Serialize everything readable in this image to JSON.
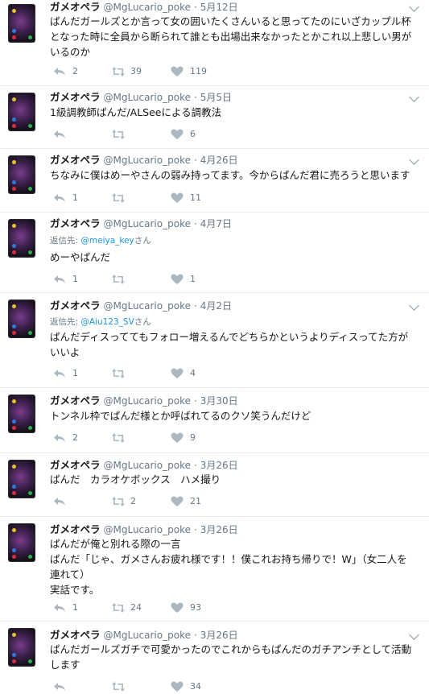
{
  "account": {
    "name": "ガメオペラ",
    "handle": "@MgLucario_poke",
    "sep": "·"
  },
  "tweets": [
    {
      "date": "5月12日",
      "reply_label": "",
      "reply_mention": "",
      "reply_suffix": "",
      "lines": [
        "ぱんだガールズとか言って女の囲いたくさんいると思ってたのにいざカップル杯",
        "となった時に全員から断られて誰とも出場出来なかったとかこれ以上悲しい男が",
        "いるのか"
      ],
      "replies": "2",
      "retweets": "39",
      "likes": "119"
    },
    {
      "date": "5月5日",
      "reply_label": "",
      "reply_mention": "",
      "reply_suffix": "",
      "lines": [
        "1級調教師ぱんだ/ALSeeによる調教法"
      ],
      "replies": "",
      "retweets": "",
      "likes": "6"
    },
    {
      "date": "4月26日",
      "reply_label": "",
      "reply_mention": "",
      "reply_suffix": "",
      "lines": [
        "ちなみに僕はめーやさんの弱み持ってます。今からぱんだ君に売ろうと思います"
      ],
      "replies": "1",
      "retweets": "",
      "likes": "11"
    },
    {
      "date": "4月7日",
      "reply_label": "返信先: ",
      "reply_mention": "@meiya_key",
      "reply_suffix": "さん",
      "lines": [
        "めーやぱんだ"
      ],
      "replies": "1",
      "retweets": "",
      "likes": "1"
    },
    {
      "date": "4月2日",
      "reply_label": "返信先: ",
      "reply_mention": "@Aiu123_SV",
      "reply_suffix": "さん",
      "lines": [
        "ぱんだディスっててもフォロー増えるんでどちらかというよりディスってた方が",
        "いいよ"
      ],
      "replies": "1",
      "retweets": "",
      "likes": "4"
    },
    {
      "date": "3月30日",
      "reply_label": "",
      "reply_mention": "",
      "reply_suffix": "",
      "lines": [
        "トンネル枠でぱんだ様とか呼ばれてるのクソ笑うんだけど"
      ],
      "replies": "2",
      "retweets": "",
      "likes": "9"
    },
    {
      "date": "3月26日",
      "reply_label": "",
      "reply_mention": "",
      "reply_suffix": "",
      "lines": [
        "ぱんだ　カラオケボックス　ハメ撮り"
      ],
      "replies": "",
      "retweets": "2",
      "likes": "21"
    },
    {
      "date": "3月26日",
      "reply_label": "",
      "reply_mention": "",
      "reply_suffix": "",
      "lines": [
        "ぱんだが俺と別れる際の一言",
        "ぱんだ「じゃ、ガメさんお疲れ様です！！僕これお持ち帰りで！W」（女二人を",
        "連れて）",
        "実話です。"
      ],
      "replies": "1",
      "retweets": "24",
      "likes": "93"
    },
    {
      "date": "3月26日",
      "reply_label": "",
      "reply_mention": "",
      "reply_suffix": "",
      "lines": [
        "ぱんだガールズガチで可愛かったのでこれからもぱんだのガチアンチとして活動",
        "します"
      ],
      "replies": "",
      "retweets": "",
      "likes": "34"
    }
  ]
}
